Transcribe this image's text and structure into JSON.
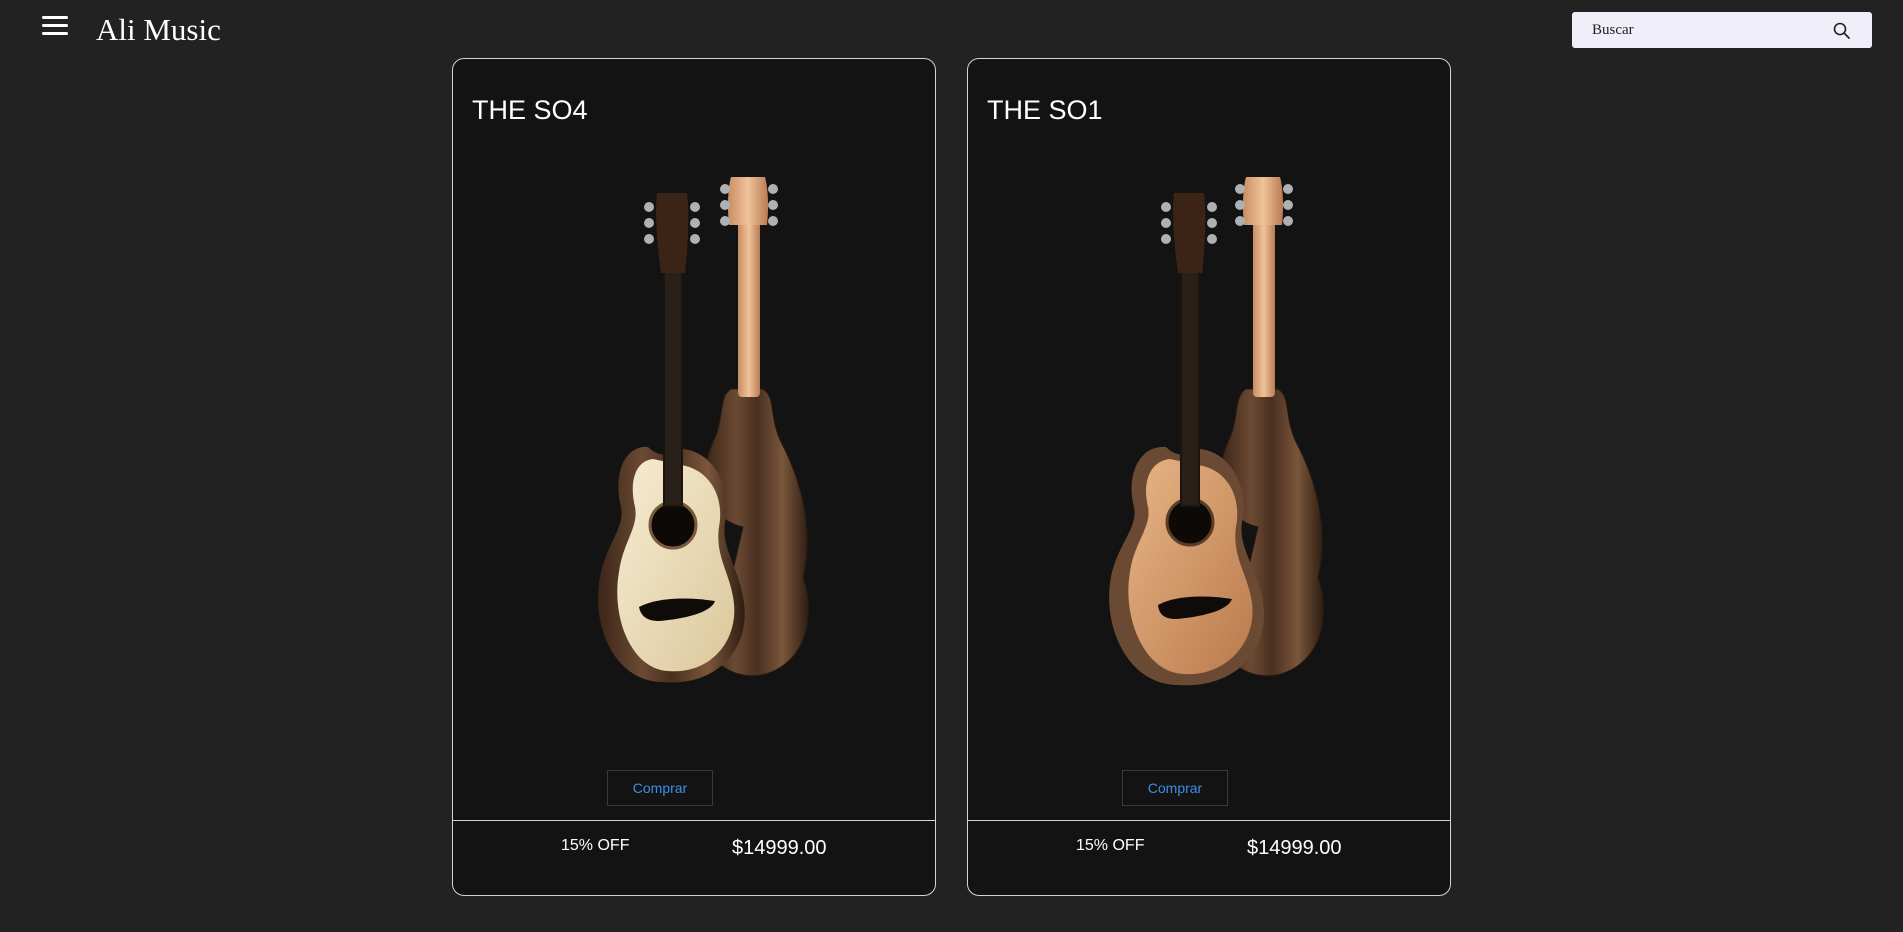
{
  "header": {
    "brand": "Ali Music",
    "search": {
      "placeholder": "Buscar",
      "value": ""
    }
  },
  "products": [
    {
      "name": "THE SO4",
      "buy_label": "Comprar",
      "discount": "15% OFF",
      "price": "$14999.00",
      "top_color": "#efe3c6"
    },
    {
      "name": "THE SO1",
      "buy_label": "Comprar",
      "discount": "15% OFF",
      "price": "$14999.00",
      "top_color": "#d9a06c"
    }
  ],
  "colors": {
    "page_background": "#222222",
    "card_background": "#131313",
    "card_border": "#d4d4d4",
    "link_accent": "#3b8fea",
    "search_background": "#f0eef8"
  }
}
